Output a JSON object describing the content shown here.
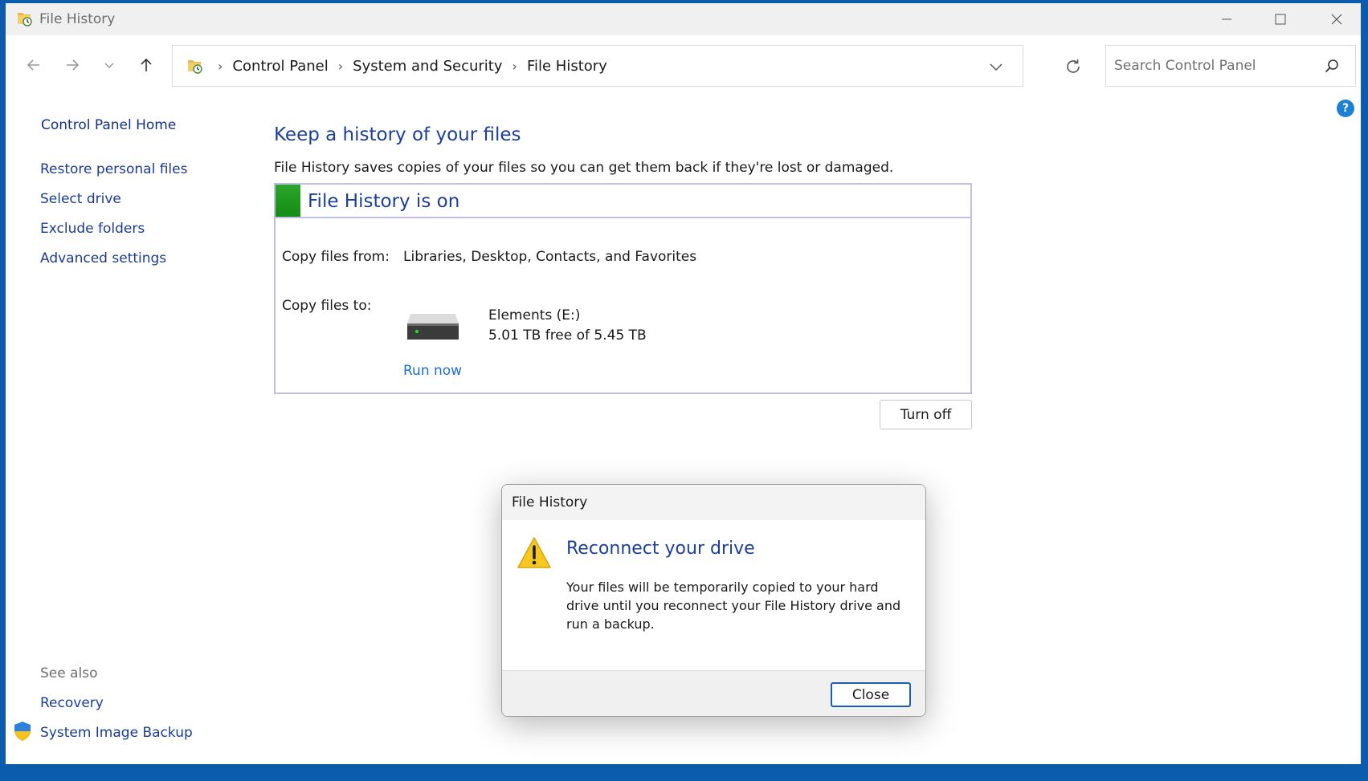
{
  "window": {
    "title": "File History",
    "icon": "file-history-folder-icon"
  },
  "address": {
    "crumbs": [
      "Control Panel",
      "System and Security",
      "File History"
    ]
  },
  "search": {
    "placeholder": "Search Control Panel"
  },
  "sidebar": {
    "home": "Control Panel Home",
    "items": [
      "Restore personal files",
      "Select drive",
      "Exclude folders",
      "Advanced settings"
    ],
    "see_also_label": "See also",
    "see_also": [
      "Recovery",
      "System Image Backup"
    ]
  },
  "main": {
    "title": "Keep a history of your files",
    "description": "File History saves copies of your files so you can get them back if they're lost or damaged.",
    "status": "File History is on",
    "copy_from_label": "Copy files from:",
    "copy_from_value": "Libraries, Desktop, Contacts, and Favorites",
    "copy_to_label": "Copy files to:",
    "drive_name": "Elements (E:)",
    "drive_space": "5.01 TB free of 5.45 TB",
    "run_now": "Run now",
    "turn_off": "Turn off"
  },
  "dialog": {
    "title": "File History",
    "heading": "Reconnect your drive",
    "body": "Your files will be temporarily copied to your hard drive until you reconnect your File History drive and run a backup.",
    "close": "Close"
  },
  "colors": {
    "accent": "#1c3f9e",
    "link": "#1a6fd0",
    "status_on": "#1a9a1a",
    "desktop": "#0b5cad"
  }
}
